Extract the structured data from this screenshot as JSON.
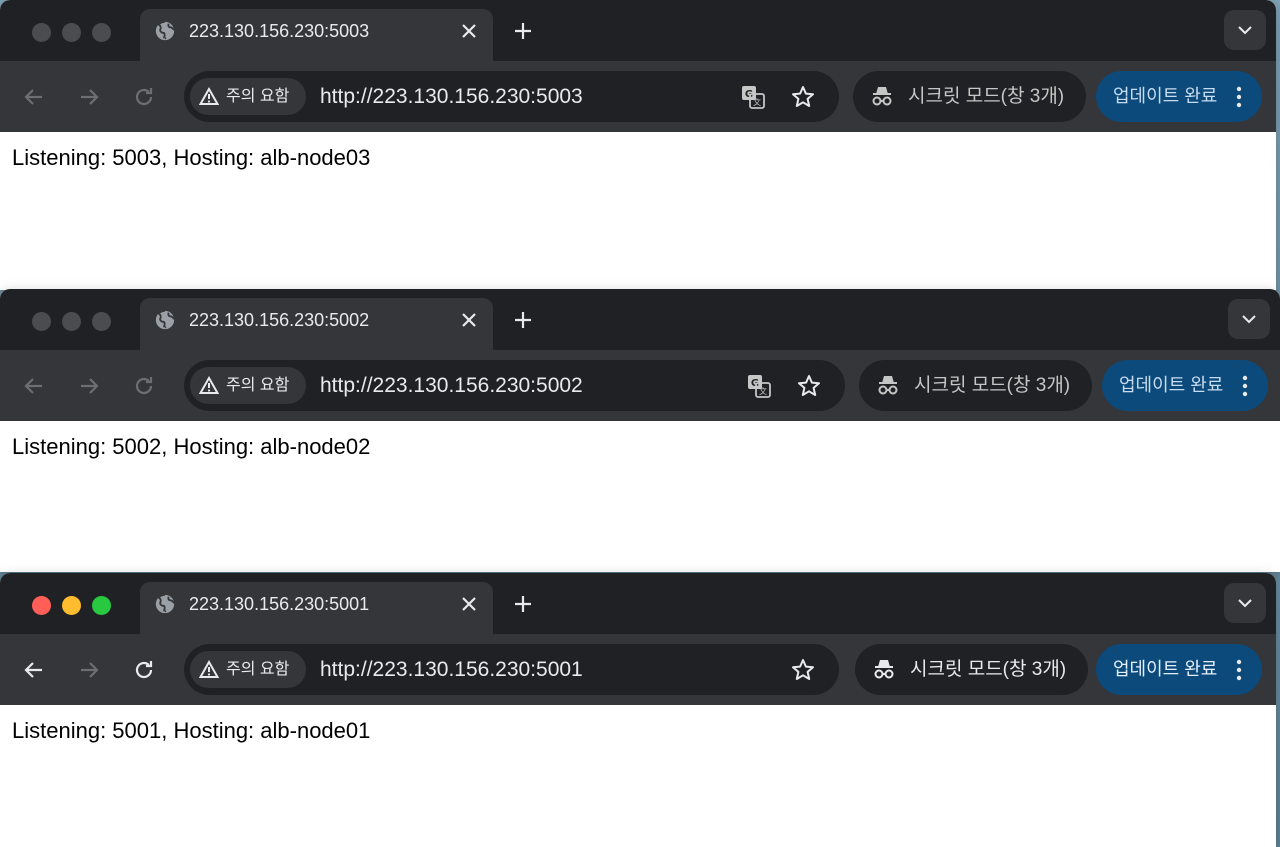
{
  "windows": [
    {
      "tab_title": "223.130.156.230:5003",
      "security_chip": "주의 요함",
      "url": "http://223.130.156.230:5003",
      "incognito_label": "시크릿 모드(창 3개)",
      "update_label": "업데이트 완료",
      "page_text": "Listening: 5003, Hosting: alb-node03",
      "active": false,
      "show_translate": true
    },
    {
      "tab_title": "223.130.156.230:5002",
      "security_chip": "주의 요함",
      "url": "http://223.130.156.230:5002",
      "incognito_label": "시크릿 모드(창 3개)",
      "update_label": "업데이트 완료",
      "page_text": "Listening: 5002, Hosting: alb-node02",
      "active": false,
      "show_translate": true
    },
    {
      "tab_title": "223.130.156.230:5001",
      "security_chip": "주의 요함",
      "url": "http://223.130.156.230:5001",
      "incognito_label": "시크릿 모드(창 3개)",
      "update_label": "업데이트 완료",
      "page_text": "Listening: 5001, Hosting: alb-node01",
      "active": true,
      "show_translate": false
    }
  ],
  "colors": {
    "tab_bar": "#202124",
    "toolbar": "#35363a",
    "update_button": "#0b4a7a",
    "traffic_red": "#ff5f57",
    "traffic_yellow": "#febc2e",
    "traffic_green": "#28c840"
  },
  "icons": [
    "globe-icon",
    "close-icon",
    "plus-icon",
    "chevron-down-icon",
    "back-arrow-icon",
    "forward-arrow-icon",
    "reload-icon",
    "warning-icon",
    "translate-icon",
    "star-icon",
    "incognito-icon",
    "more-vert-icon"
  ]
}
